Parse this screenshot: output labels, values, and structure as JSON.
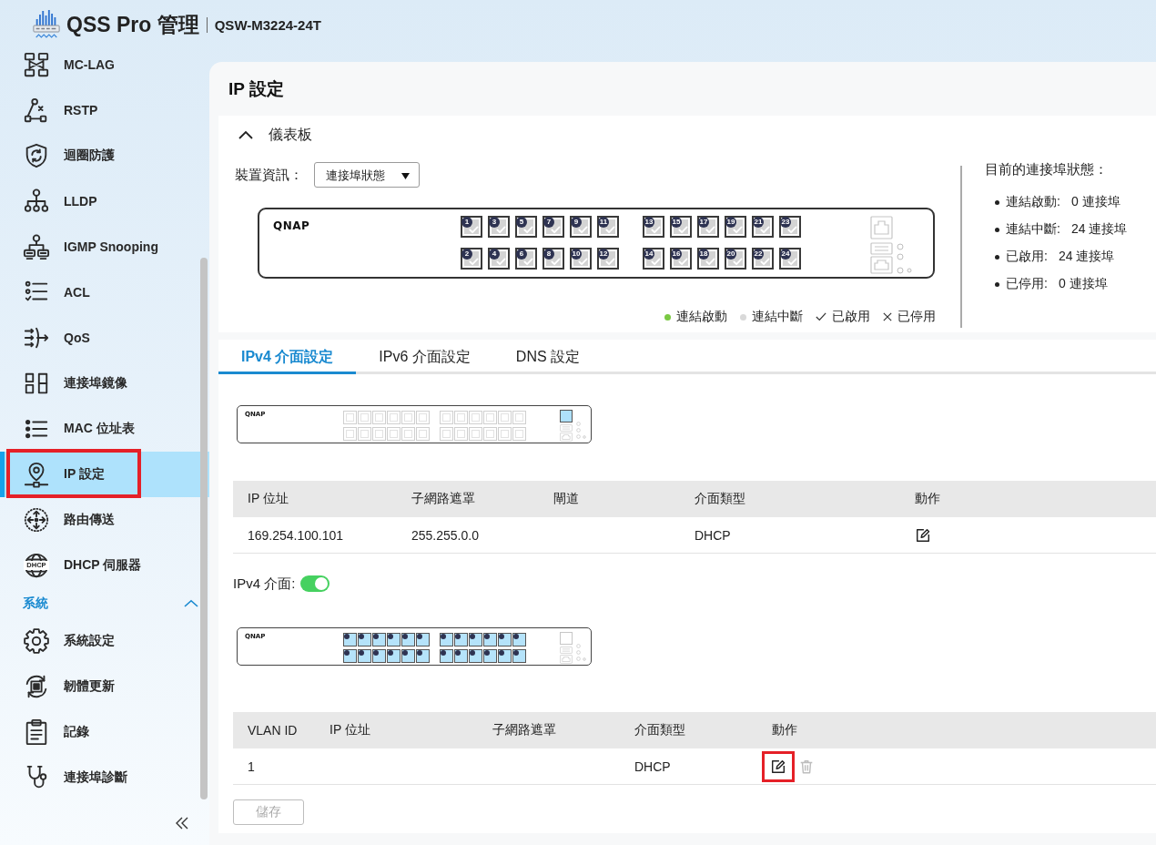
{
  "header": {
    "app_title": "QSS Pro 管理",
    "model": "QSW-M3224-24T"
  },
  "sidebar": {
    "items": [
      {
        "label": "MC-LAG",
        "selected": false,
        "highlighted": false
      },
      {
        "label": "RSTP",
        "selected": false,
        "highlighted": false
      },
      {
        "label": "迴圈防護",
        "selected": false,
        "highlighted": false
      },
      {
        "label": "LLDP",
        "selected": false,
        "highlighted": false
      },
      {
        "label": "IGMP Snooping",
        "selected": false,
        "highlighted": false
      },
      {
        "label": "ACL",
        "selected": false,
        "highlighted": false
      },
      {
        "label": "QoS",
        "selected": false,
        "highlighted": false
      },
      {
        "label": "連接埠鏡像",
        "selected": false,
        "highlighted": false
      },
      {
        "label": "MAC 位址表",
        "selected": false,
        "highlighted": false
      },
      {
        "label": "IP 設定",
        "selected": true,
        "highlighted": true
      },
      {
        "label": "路由傳送",
        "selected": false,
        "highlighted": false
      },
      {
        "label": "DHCP 伺服器",
        "icon_text": "DHCP",
        "selected": false,
        "highlighted": false
      }
    ],
    "sections": [
      {
        "label": "系統",
        "expanded": true,
        "items": [
          {
            "label": "系統設定",
            "selected": false,
            "highlighted": false
          },
          {
            "label": "韌體更新",
            "selected": false,
            "highlighted": false
          },
          {
            "label": "記錄",
            "selected": false,
            "highlighted": false
          },
          {
            "label": "連接埠診斷",
            "selected": false,
            "highlighted": false
          }
        ]
      }
    ]
  },
  "page": {
    "title": "IP 設定"
  },
  "dashboard": {
    "title": "儀表板",
    "expanded": true,
    "device_info": {
      "label": "裝置資訊：",
      "dropdown": {
        "value": "連接埠狀態"
      }
    },
    "switch": {
      "brand": "QNAP",
      "ports": [
        {
          "label": "1",
          "link_up": false,
          "enabled": true
        },
        {
          "label": "2",
          "link_up": false,
          "enabled": true
        },
        {
          "label": "3",
          "link_up": false,
          "enabled": true
        },
        {
          "label": "4",
          "link_up": false,
          "enabled": true
        },
        {
          "label": "5",
          "link_up": false,
          "enabled": true
        },
        {
          "label": "6",
          "link_up": false,
          "enabled": true
        },
        {
          "label": "7",
          "link_up": false,
          "enabled": true
        },
        {
          "label": "8",
          "link_up": false,
          "enabled": true
        },
        {
          "label": "9",
          "link_up": false,
          "enabled": true
        },
        {
          "label": "10",
          "link_up": false,
          "enabled": true
        },
        {
          "label": "11",
          "link_up": false,
          "enabled": true
        },
        {
          "label": "12",
          "link_up": false,
          "enabled": true
        },
        {
          "label": "13",
          "link_up": false,
          "enabled": true
        },
        {
          "label": "14",
          "link_up": false,
          "enabled": true
        },
        {
          "label": "15",
          "link_up": false,
          "enabled": true
        },
        {
          "label": "16",
          "link_up": false,
          "enabled": true
        },
        {
          "label": "17",
          "link_up": false,
          "enabled": true
        },
        {
          "label": "18",
          "link_up": false,
          "enabled": true
        },
        {
          "label": "19",
          "link_up": false,
          "enabled": true
        },
        {
          "label": "20",
          "link_up": false,
          "enabled": true
        },
        {
          "label": "21",
          "link_up": false,
          "enabled": true
        },
        {
          "label": "22",
          "link_up": false,
          "enabled": true
        },
        {
          "label": "23",
          "link_up": false,
          "enabled": true
        },
        {
          "label": "24",
          "link_up": false,
          "enabled": true
        }
      ]
    },
    "legend": [
      {
        "kind": "dot",
        "label": "連結啟動",
        "color": "#7ac943"
      },
      {
        "kind": "dot",
        "label": "連結中斷",
        "color": "#d9d9d9"
      },
      {
        "kind": "check",
        "label": "已啟用"
      },
      {
        "kind": "cross",
        "label": "已停用"
      }
    ],
    "port_status": {
      "title": "目前的連接埠狀態：",
      "items": [
        {
          "label": "連結啟動:",
          "value": "0 連接埠"
        },
        {
          "label": "連結中斷:",
          "value": "24 連接埠"
        },
        {
          "label": "已啟用:",
          "value": "24 連接埠"
        },
        {
          "label": "已停用:",
          "value": "0 連接埠"
        }
      ]
    }
  },
  "tabs": [
    {
      "label": "IPv4 介面設定",
      "selected": true
    },
    {
      "label": "IPv6 介面設定",
      "selected": false
    },
    {
      "label": "DNS 設定",
      "selected": false
    }
  ],
  "ipv4_settings": {
    "switch": {
      "brand": "QNAP",
      "ports": [
        {
          "selected": false
        },
        {
          "selected": false
        },
        {
          "selected": false
        },
        {
          "selected": false
        },
        {
          "selected": false
        },
        {
          "selected": false
        },
        {
          "selected": false
        },
        {
          "selected": false
        },
        {
          "selected": false
        },
        {
          "selected": false
        },
        {
          "selected": false
        },
        {
          "selected": false
        },
        {
          "selected": false
        },
        {
          "selected": false
        },
        {
          "selected": false
        },
        {
          "selected": false
        },
        {
          "selected": false
        },
        {
          "selected": false
        },
        {
          "selected": false
        },
        {
          "selected": false
        },
        {
          "selected": false
        },
        {
          "selected": false
        },
        {
          "selected": false
        },
        {
          "selected": false
        }
      ],
      "management_port": {
        "selected": true
      }
    },
    "table": {
      "columns": [
        "IP 位址",
        "子網路遮罩",
        "閘道",
        "介面類型",
        "動作"
      ],
      "rows": [
        {
          "ip_address": "169.254.100.101",
          "subnet_mask": "255.255.0.0",
          "interface_type": "DHCP",
          "actions": [
            {
              "kind": "edit",
              "disabled": false,
              "highlighted": false
            }
          ]
        }
      ]
    },
    "interface_toggle": {
      "label": "IPv4 介面:",
      "on": true
    },
    "vlan_switch": {
      "brand": "QNAP",
      "ports": [
        {
          "selected": true
        },
        {
          "selected": true
        },
        {
          "selected": true
        },
        {
          "selected": true
        },
        {
          "selected": true
        },
        {
          "selected": true
        },
        {
          "selected": true
        },
        {
          "selected": true
        },
        {
          "selected": true
        },
        {
          "selected": true
        },
        {
          "selected": true
        },
        {
          "selected": true
        },
        {
          "selected": true
        },
        {
          "selected": true
        },
        {
          "selected": true
        },
        {
          "selected": true
        },
        {
          "selected": true
        },
        {
          "selected": true
        },
        {
          "selected": true
        },
        {
          "selected": true
        },
        {
          "selected": true
        },
        {
          "selected": true
        },
        {
          "selected": true
        },
        {
          "selected": true
        }
      ],
      "management_port": {
        "selected": false
      }
    },
    "vlan_table": {
      "columns": [
        "VLAN ID",
        "IP 位址",
        "子網路遮罩",
        "介面類型",
        "動作"
      ],
      "rows": [
        {
          "vlan_id": "1",
          "interface_type": "DHCP",
          "actions": [
            {
              "kind": "edit",
              "disabled": false,
              "highlighted": true
            },
            {
              "kind": "delete",
              "disabled": true,
              "highlighted": false
            }
          ]
        }
      ]
    },
    "save_button": {
      "label": "儲存",
      "disabled": true
    }
  }
}
